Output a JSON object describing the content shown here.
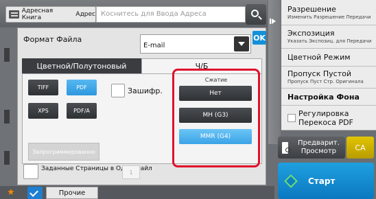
{
  "header": {
    "address_book_label": "Адресная Книга",
    "address_label": "Адрес",
    "address_placeholder": "Коснитесь для Ввода Адреса"
  },
  "dialog": {
    "format_label": "Формат Файла",
    "format_value": "E-mail",
    "ok_label": "OK",
    "tabs": {
      "color": "Цветной/Полутоновый",
      "bw": "Ч/Б",
      "active": "Ч/Б"
    },
    "file_types": [
      {
        "label": "TIFF",
        "selected": false
      },
      {
        "label": "PDF",
        "selected": true
      },
      {
        "label": "XPS",
        "selected": false
      },
      {
        "label": "PDF/A",
        "selected": false
      }
    ],
    "encryption_label": "Зашифр.",
    "encryption_checked": false,
    "compression": {
      "label": "Сжатие",
      "options": [
        {
          "label": "Нет",
          "selected": false
        },
        {
          "label": "MH (G3)",
          "selected": false
        },
        {
          "label": "MMR (G4)",
          "selected": true
        }
      ]
    },
    "programmed_label": "Запрограммированно",
    "pages_per_file_label": "Заданные Страницы в Один Файл",
    "pages_per_file_checked": false,
    "pages_per_file_value": "1"
  },
  "right_panel": {
    "items": [
      {
        "main": "Разрешение",
        "sub": "Изменить Разрешение Передачи"
      },
      {
        "main": "Экспозиция",
        "sub": "Указать Экспозиц. для Передачи"
      },
      {
        "main": "Цветной Режим",
        "sub": ""
      },
      {
        "main": "Пропуск Пустой",
        "sub": "Пропуск Пуст Стр. Оригинала"
      },
      {
        "main": "Настройка Фона",
        "sub": ""
      },
      {
        "main": "Регулировка Перекоса PDF",
        "sub": ""
      }
    ],
    "preview_label": "Предварит. Просмотр",
    "ca_label": "CA",
    "start_label": "Старт"
  },
  "footer": {
    "more_label": "Прочие"
  },
  "colors": {
    "accent_blue": "#2e98de",
    "selected_blue": "#3aa3e6",
    "highlight_red": "#e0102c",
    "ca_yellow": "#e2c400",
    "start_blue": "#0b78c0",
    "star_orange": "#f28c00"
  }
}
